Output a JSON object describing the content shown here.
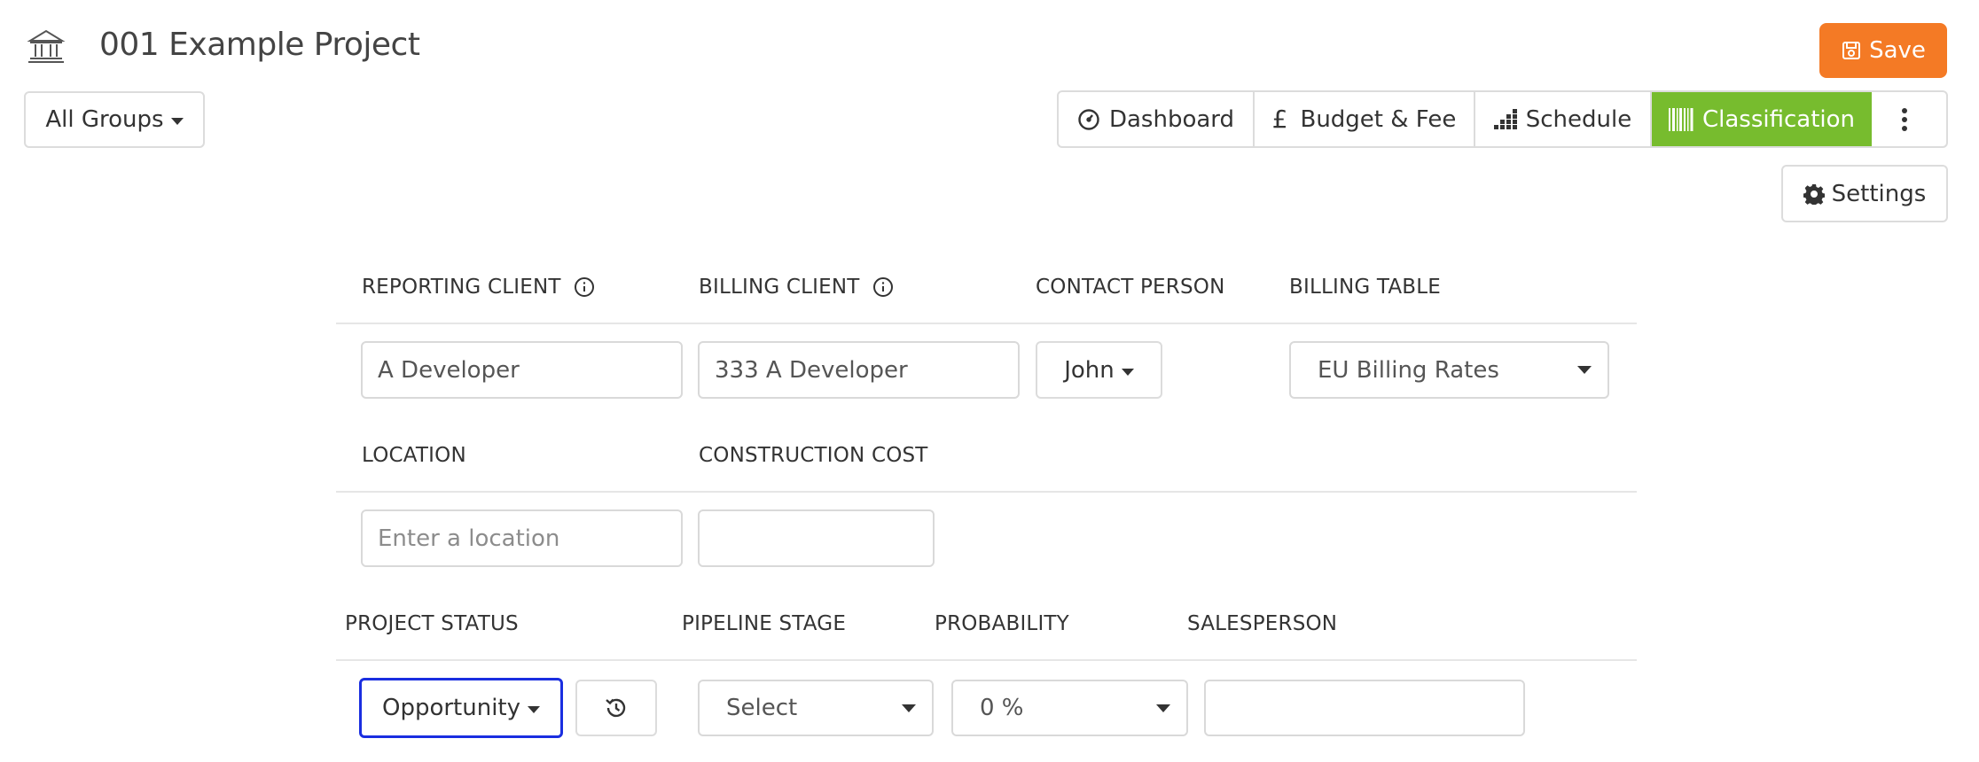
{
  "header": {
    "title": "001 Example Project",
    "save_label": "Save",
    "groups_label": "All Groups"
  },
  "nav": {
    "tabs": [
      {
        "label": "Dashboard",
        "icon": "dashboard-gauge-icon"
      },
      {
        "label": "Budget & Fee",
        "icon": "pound-icon"
      },
      {
        "label": "Schedule",
        "icon": "schedule-bars-icon"
      },
      {
        "label": "Classification",
        "icon": "barcode-icon",
        "active": true
      }
    ],
    "more_icon": "vertical-ellipsis-icon",
    "settings_label": "Settings"
  },
  "form": {
    "row1": {
      "reporting_client_label": "REPORTING CLIENT",
      "reporting_client_value": "A Developer",
      "billing_client_label": "BILLING CLIENT",
      "billing_client_value": "333 A Developer",
      "contact_person_label": "CONTACT PERSON",
      "contact_person_value": "John",
      "billing_table_label": "BILLING TABLE",
      "billing_table_value": "EU Billing Rates"
    },
    "row2": {
      "location_label": "LOCATION",
      "location_placeholder": "Enter a location",
      "construction_cost_label": "CONSTRUCTION COST",
      "construction_cost_value": ""
    },
    "row3": {
      "project_status_label": "PROJECT STATUS",
      "project_status_value": "Opportunity",
      "pipeline_stage_label": "PIPELINE STAGE",
      "pipeline_stage_value": "Select",
      "probability_label": "PROBABILITY",
      "probability_value": "0 %",
      "salesperson_label": "SALESPERSON",
      "salesperson_value": ""
    }
  },
  "colors": {
    "save": "#f47a25",
    "active_tab": "#77bc2e",
    "focus_border": "#1a2ee0"
  }
}
